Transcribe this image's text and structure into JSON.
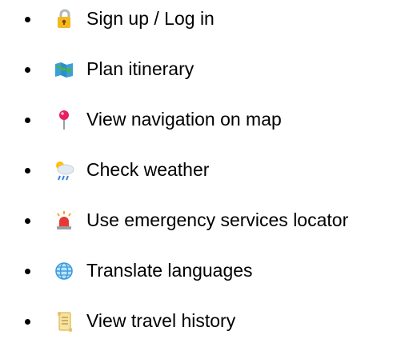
{
  "features": [
    {
      "icon": "padlock-icon",
      "label": "Sign up / Log in"
    },
    {
      "icon": "map-icon",
      "label": "Plan itinerary"
    },
    {
      "icon": "location-pin-icon",
      "label": "View navigation on map"
    },
    {
      "icon": "cloud-rain-icon",
      "label": "Check weather"
    },
    {
      "icon": "siren-icon",
      "label": "Use emergency services locator"
    },
    {
      "icon": "globe-icon",
      "label": "Translate languages"
    },
    {
      "icon": "scroll-icon",
      "label": "View travel history"
    }
  ]
}
